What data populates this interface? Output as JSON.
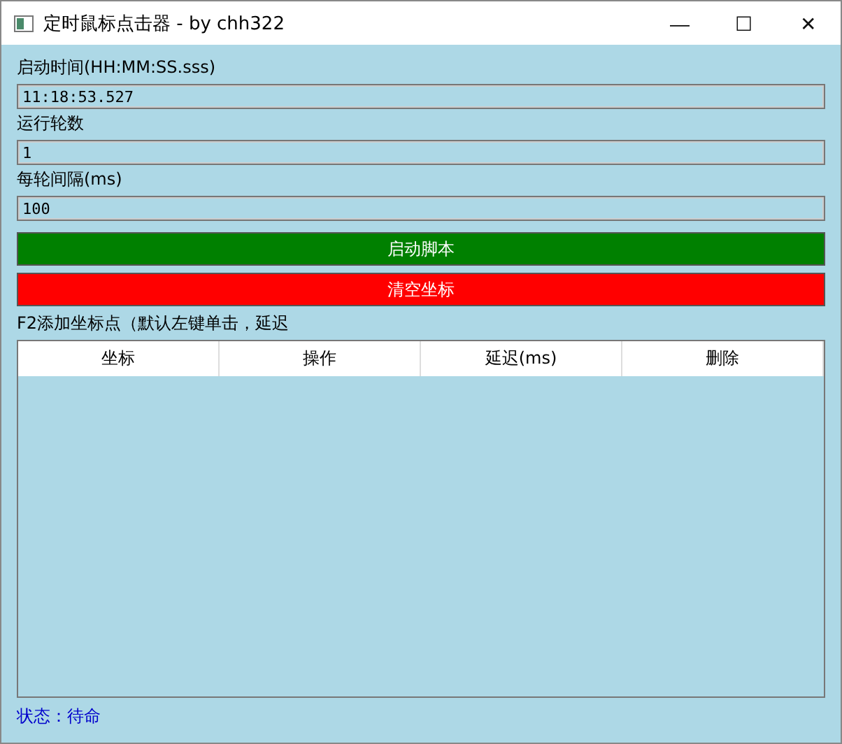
{
  "window": {
    "title": "定时鼠标点击器 - by chh322",
    "controls": [
      "—",
      "☐",
      "✕"
    ]
  },
  "fields": [
    {
      "label": "启动时间(HH:MM:SS.sss)",
      "value": "11:18:53.527"
    },
    {
      "label": "运行轮数",
      "value": "1"
    },
    {
      "label": "每轮间隔(ms)",
      "value": "100"
    }
  ],
  "buttons": [
    {
      "label": "启动脚本",
      "color": "#008000"
    },
    {
      "label": "清空坐标",
      "color": "#ff0000"
    }
  ],
  "hint": "F2添加坐标点（默认左键单击，延迟",
  "table": {
    "columns": [
      "坐标",
      "操作",
      "延迟(ms)",
      "删除"
    ]
  },
  "status_bar": "状态：待命"
}
